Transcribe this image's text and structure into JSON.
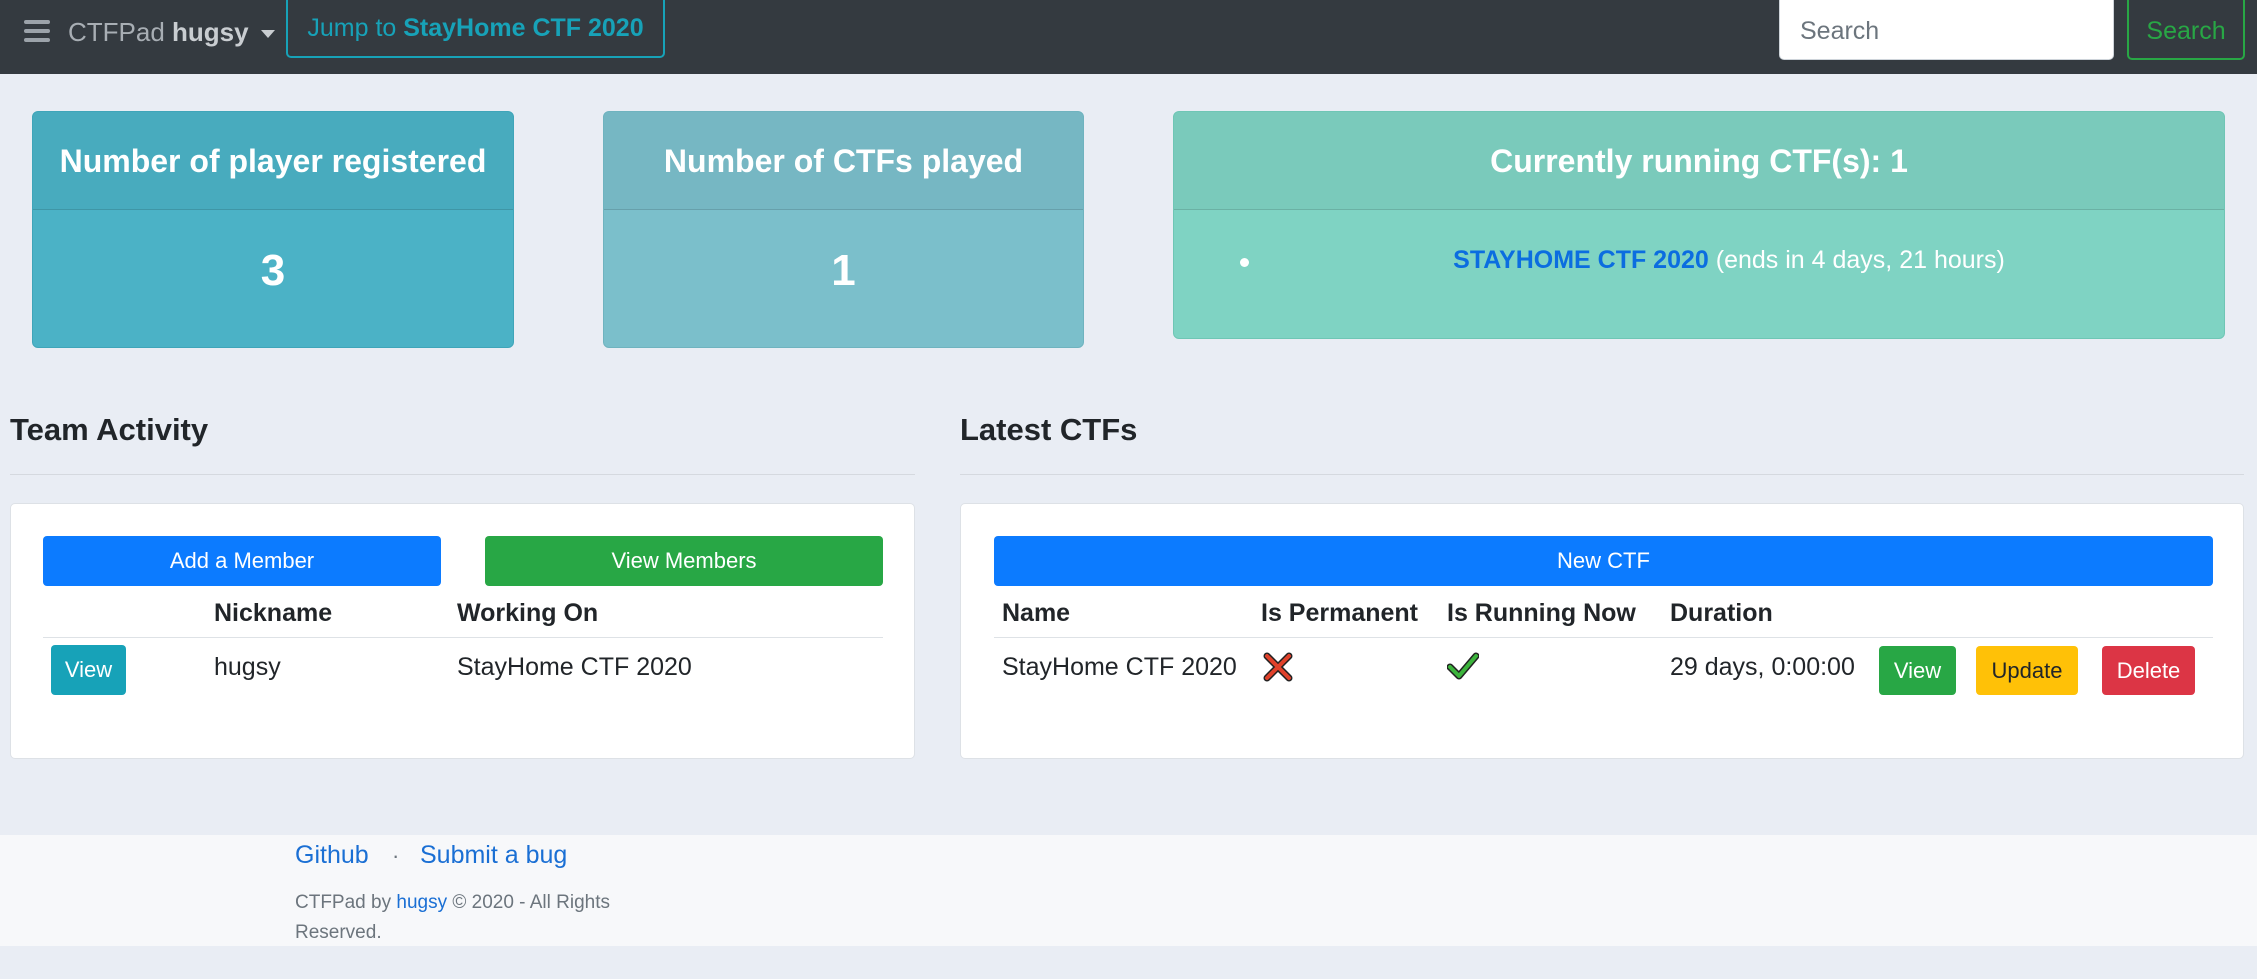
{
  "navbar": {
    "brand": "CTFPad",
    "user": "hugsy",
    "jump_prefix": "Jump to",
    "jump_target": "StayHome CTF 2020",
    "search_placeholder": "Search",
    "search_button": "Search"
  },
  "stats": {
    "players": {
      "label": "Number of player registered",
      "value": "3"
    },
    "ctfs_played": {
      "label": "Number of CTFs played",
      "value": "1"
    },
    "running": {
      "label": "Currently running CTF(s): 1",
      "items": [
        {
          "name": "STAYHOME CTF 2020",
          "note": "(ends in 4 days, 21 hours)"
        }
      ]
    }
  },
  "team_activity": {
    "title": "Team Activity",
    "add_member": "Add a Member",
    "view_members": "View Members",
    "columns": [
      "",
      "Nickname",
      "Working On"
    ],
    "rows": [
      {
        "action": "View",
        "nickname": "hugsy",
        "working_on": "StayHome CTF 2020"
      }
    ]
  },
  "latest_ctfs": {
    "title": "Latest CTFs",
    "new_ctf": "New CTF",
    "columns": [
      "Name",
      "Is Permanent",
      "Is Running Now",
      "Duration"
    ],
    "rows": [
      {
        "name": "StayHome CTF 2020",
        "is_permanent": false,
        "is_running_now": true,
        "duration": "29 days, 0:00:00",
        "actions": [
          "View",
          "Update",
          "Delete"
        ]
      }
    ]
  },
  "footer": {
    "github": "Github",
    "separator": "·",
    "submit_bug": "Submit a bug",
    "copy_prefix": "CTFPad by",
    "copy_user": "hugsy",
    "copy_suffix": "© 2020 - All Rights Reserved."
  },
  "colors": {
    "navbar": "#343a40",
    "primary": "#0c7bff",
    "success": "#28a745",
    "info": "#17a2b8",
    "warning": "#ffc107",
    "danger": "#dc3545"
  }
}
